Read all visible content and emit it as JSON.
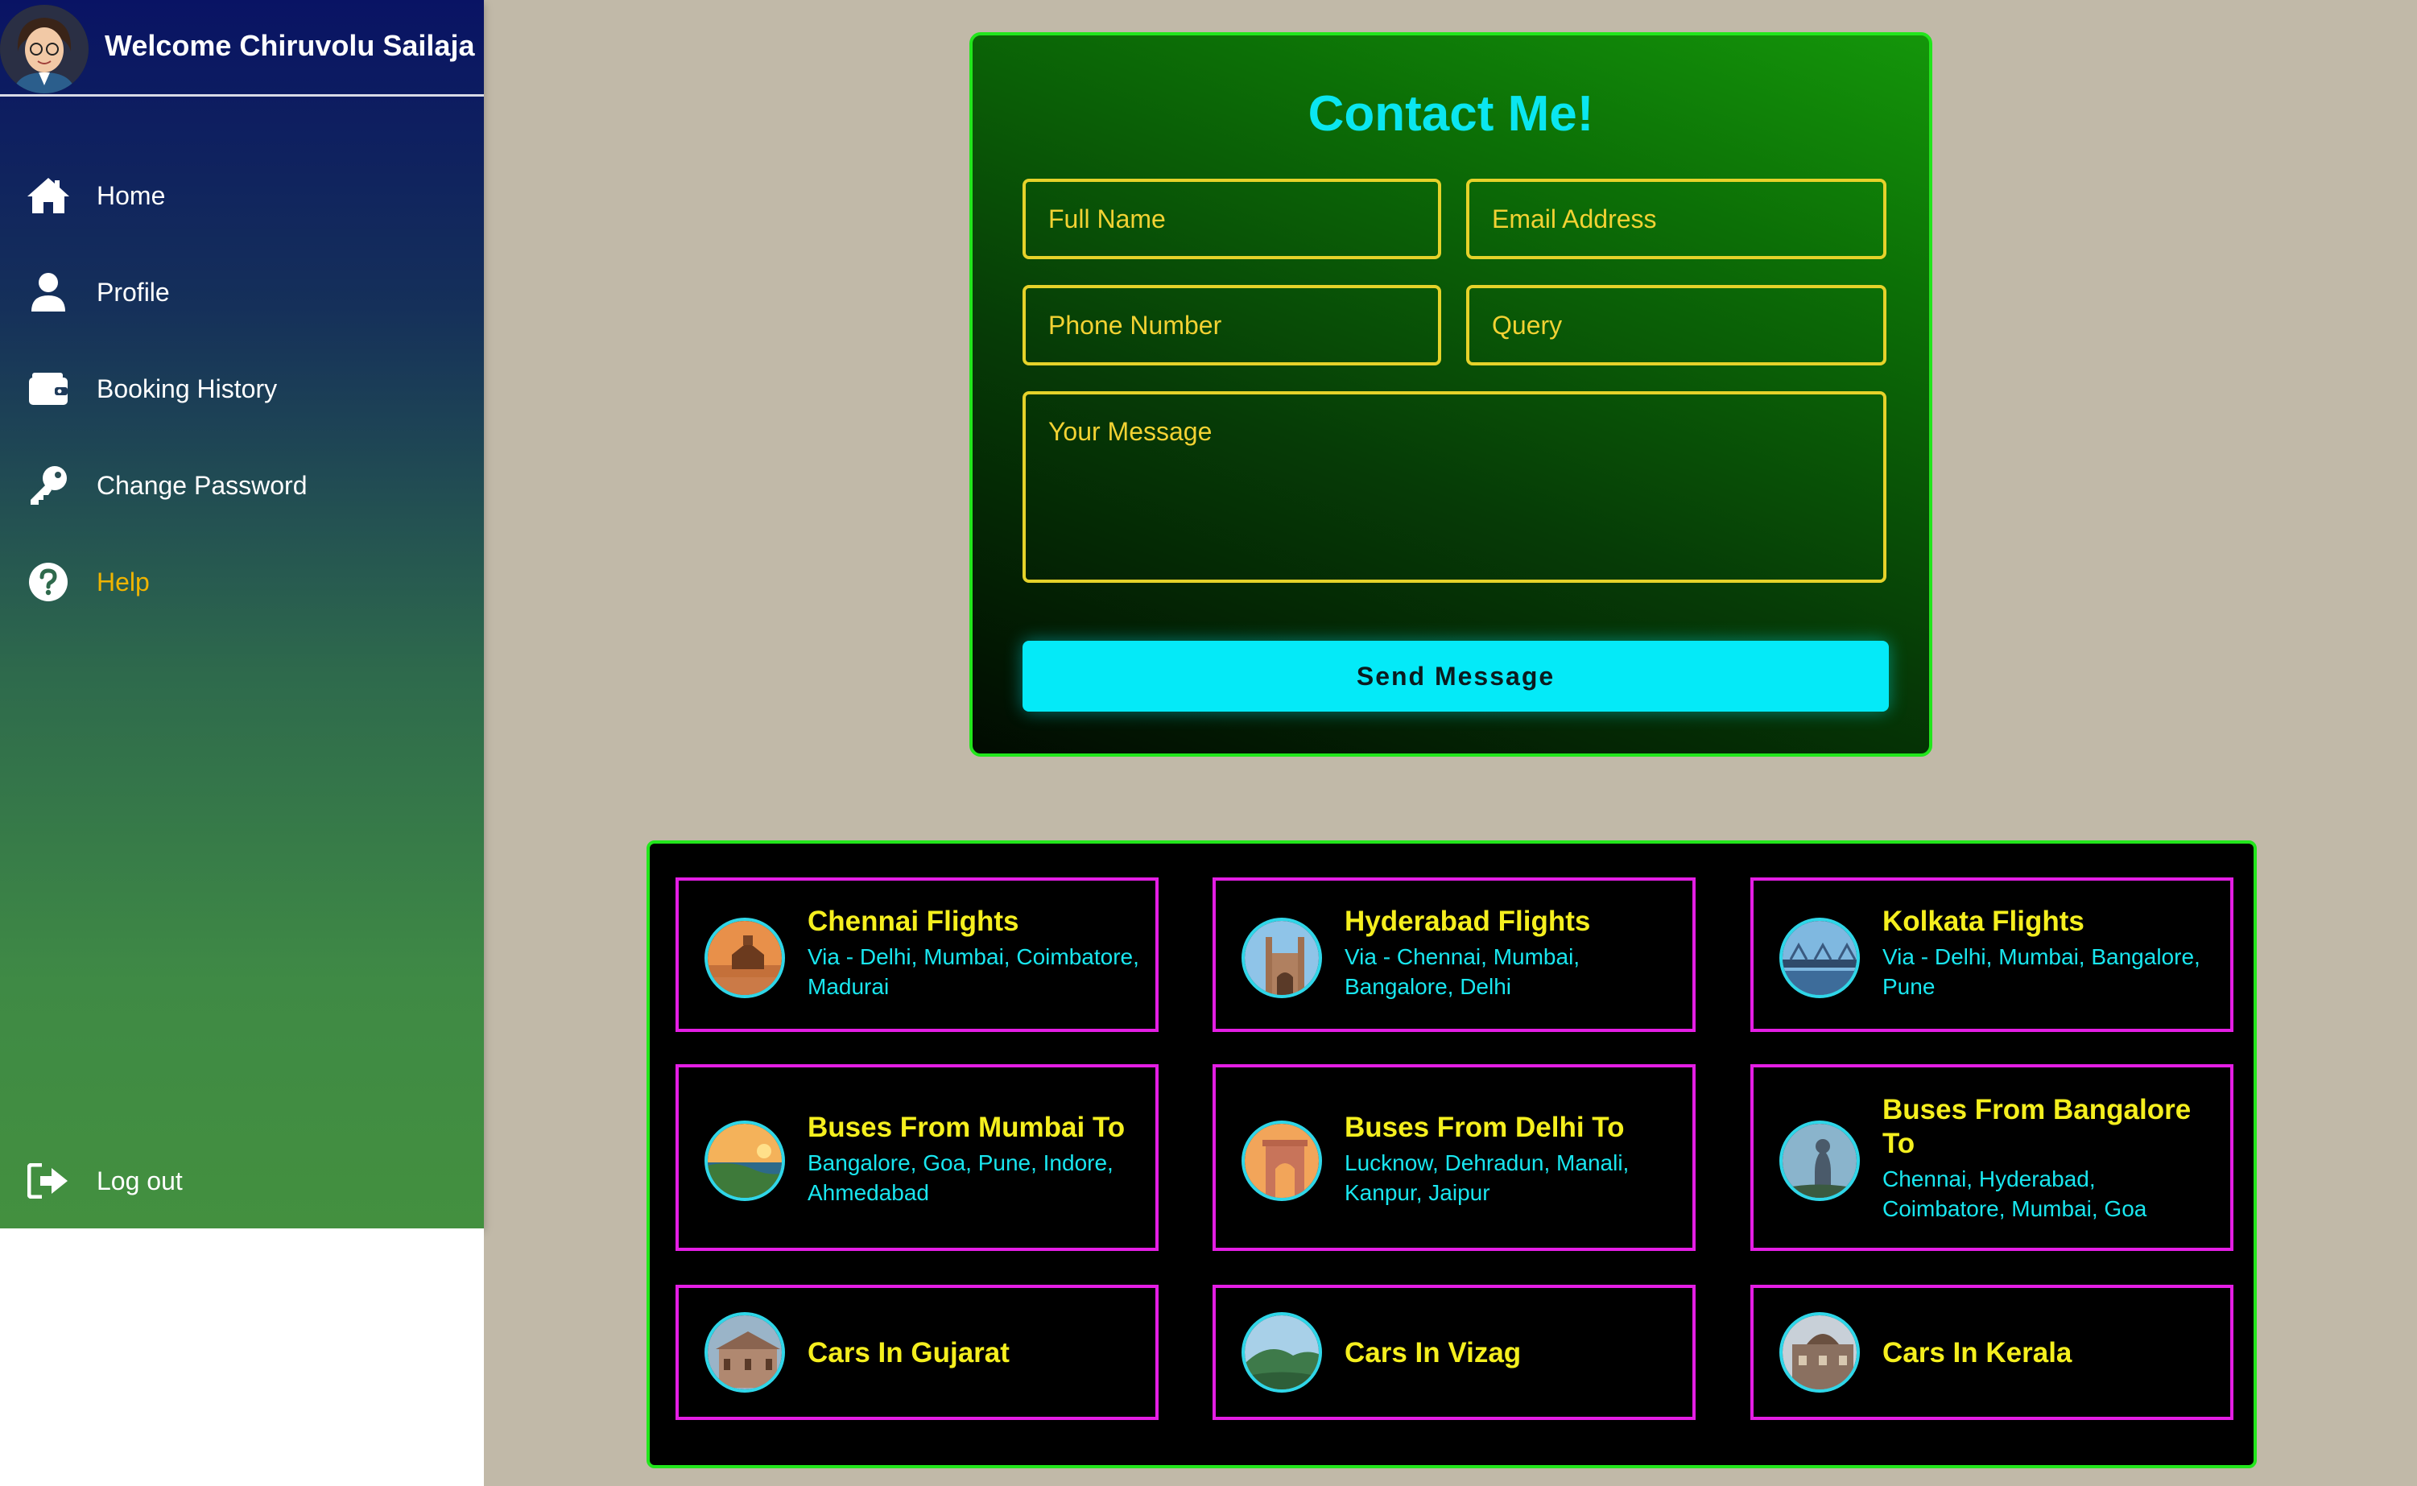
{
  "sidebar": {
    "welcome": "Welcome Chiruvolu Sailaja",
    "items": [
      {
        "label": "Home",
        "icon": "home-icon"
      },
      {
        "label": "Profile",
        "icon": "user-icon"
      },
      {
        "label": "Booking History",
        "icon": "wallet-icon"
      },
      {
        "label": "Change Password",
        "icon": "key-icon"
      },
      {
        "label": "Help",
        "icon": "help-circle-icon",
        "active": true
      }
    ],
    "logout": {
      "label": "Log out",
      "icon": "logout-icon"
    }
  },
  "contact": {
    "title": "Contact Me!",
    "full_name_placeholder": "Full Name",
    "email_placeholder": "Email Address",
    "phone_placeholder": "Phone Number",
    "query_placeholder": "Query",
    "message_placeholder": "Your Message",
    "send_label": "Send Message"
  },
  "destinations": [
    {
      "title": "Chennai Flights",
      "sub": "Via - Delhi, Mumbai, Coimbatore, Madurai"
    },
    {
      "title": "Hyderabad Flights",
      "sub": "Via - Chennai, Mumbai, Bangalore, Delhi"
    },
    {
      "title": "Kolkata Flights",
      "sub": "Via - Delhi, Mumbai, Bangalore, Pune"
    },
    {
      "title": "Buses From Mumbai To",
      "sub": "Bangalore, Goa, Pune, Indore, Ahmedabad"
    },
    {
      "title": "Buses From Delhi To",
      "sub": "Lucknow, Dehradun, Manali, Kanpur, Jaipur"
    },
    {
      "title": "Buses From Bangalore To",
      "sub": "Chennai, Hyderabad, Coimbatore, Mumbai, Goa"
    },
    {
      "title": "Cars In Gujarat",
      "sub": ""
    },
    {
      "title": "Cars In Vizag",
      "sub": ""
    },
    {
      "title": "Cars In Kerala",
      "sub": ""
    }
  ],
  "colors": {
    "accent_cyan": "#04eaf8",
    "field_yellow": "#e5d22a",
    "tile_border_magenta": "#e41ee4",
    "panel_border_green": "#22e61c",
    "help_active": "#f0b400"
  }
}
